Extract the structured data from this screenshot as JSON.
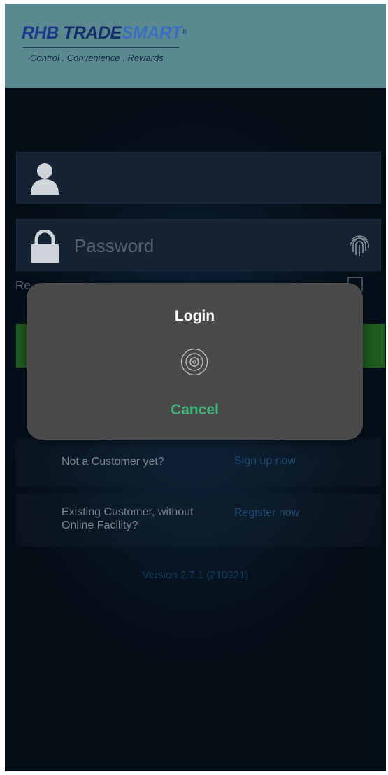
{
  "header": {
    "logo": {
      "part1": "RHB ",
      "part2": "TRADE",
      "part3": "SMART",
      "mark": "®"
    },
    "tagline": "Control . Convenience . Rewards"
  },
  "login_form": {
    "username": {
      "value": "",
      "placeholder": "",
      "icon": "user-icon"
    },
    "password": {
      "value": "",
      "placeholder": "Password",
      "icon": "lock-icon",
      "trailing_icon": "fingerprint-icon"
    },
    "remember_label": "Re",
    "login_button_color": "#1f5e1f"
  },
  "links": {
    "signup_label": "Not a Customer yet?",
    "signup_link": "Sign up now",
    "register_label": "Existing Customer, without Online Facility?",
    "register_link": "Register now"
  },
  "version": "Version 2.7.1 (210921)",
  "dialog": {
    "title": "Login",
    "icon": "fingerprint-icon",
    "cancel_label": "Cancel",
    "cancel_color": "#3fb67a"
  }
}
